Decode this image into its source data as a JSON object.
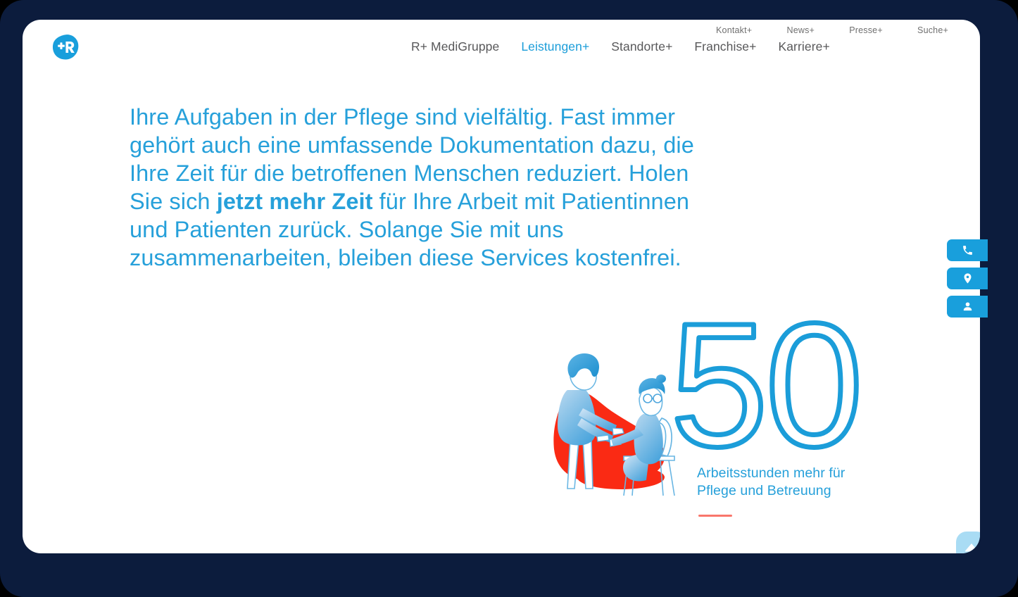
{
  "brand": {
    "logo_icon": "r-plus-logo-icon",
    "logo_alt": "R+",
    "brand_color": "#199fdc"
  },
  "header": {
    "utility_nav": [
      {
        "label": "Kontakt+",
        "icon": ""
      },
      {
        "label": "News+",
        "icon": ""
      },
      {
        "label": "Presse+",
        "icon": ""
      },
      {
        "label": "Suche+",
        "icon": "search-icon"
      }
    ],
    "main_nav": [
      {
        "label": "R+ MediGruppe",
        "active": false
      },
      {
        "label": "Leistungen+",
        "active": true
      },
      {
        "label": "Standorte+",
        "active": false
      },
      {
        "label": "Franchise+",
        "active": false
      },
      {
        "label": "Karriere+",
        "active": false
      }
    ],
    "active_nav_color": "#1b9dd9",
    "nav_color": "#58585a",
    "utility_color": "#6f6f6f"
  },
  "hero": {
    "heading_part_1": "Ihre Aufgaben in der Pflege sind vielfältig. Fast immer gehört auch eine umfassende Dokumentation dazu, die Ihre Zeit für die betroffenen Menschen reduziert. Holen Sie sich ",
    "heading_emphasis": "jetzt mehr Zeit",
    "heading_part_2": " für Ihre Arbeit mit Patientinnen und Patienten zurück. Solange Sie mit uns zusammenarbeiten, bleiben diese Services kostenfrei.",
    "heading_color": "#26a0da"
  },
  "stat": {
    "number": "50",
    "caption_line_1": "Arbeitsstunden mehr für",
    "caption_line_2": "Pflege und Betreuung",
    "number_color": "#1b9dd9",
    "caption_color": "#26a0da",
    "rule_color": "#f9766b",
    "illustration_name": "caregiver-and-patient-illustration",
    "illustration_colors": {
      "cape_red": "#fa2a14",
      "figure_blue": "#4da6dd",
      "figure_light": "#cfe4f5"
    }
  },
  "side_tabs": [
    {
      "name": "phone-icon",
      "label": "Telefon"
    },
    {
      "name": "location-pin-icon",
      "label": "Standort"
    },
    {
      "name": "person-icon",
      "label": "Kontaktperson"
    }
  ],
  "scroll_top": {
    "icon": "arrow-up-icon",
    "label": "Nach oben",
    "color": "#a9dcf4"
  },
  "frame": {
    "outer_color": "#0c1c3d",
    "page_color": "#ffffff"
  }
}
